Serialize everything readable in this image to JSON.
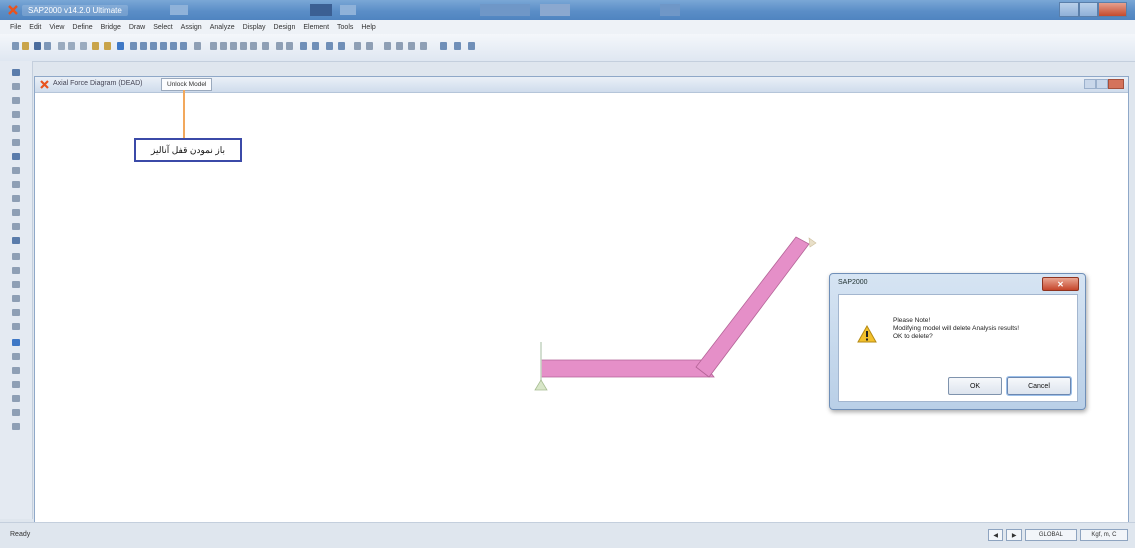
{
  "window": {
    "title": "SAP2000 v14.2.0 Ultimate"
  },
  "menu": {
    "items": [
      "File",
      "Edit",
      "View",
      "Define",
      "Bridge",
      "Draw",
      "Select",
      "Assign",
      "Analyze",
      "Display",
      "Design",
      "Element",
      "Tools",
      "Help"
    ]
  },
  "document": {
    "title": "Axial Force Diagram (DEAD)",
    "tab_label": "Unlock Model"
  },
  "annotation": {
    "text": "باز نمودن قفل آنالیز"
  },
  "dialog": {
    "title": "SAP2000",
    "message_line1": "Please Note!",
    "message_line2": "Modifying model will delete Analysis results!",
    "message_line3": "OK to delete?",
    "ok_label": "OK",
    "cancel_label": "Cancel",
    "close_symbol": "✕"
  },
  "status": {
    "text": "Ready",
    "units": "Kgf, m, C",
    "coord_system": "GLOBAL"
  },
  "colors": {
    "frame": "#e58fc8",
    "annotation_border": "#3b4aa8",
    "callout_line": "#f2a85c"
  }
}
